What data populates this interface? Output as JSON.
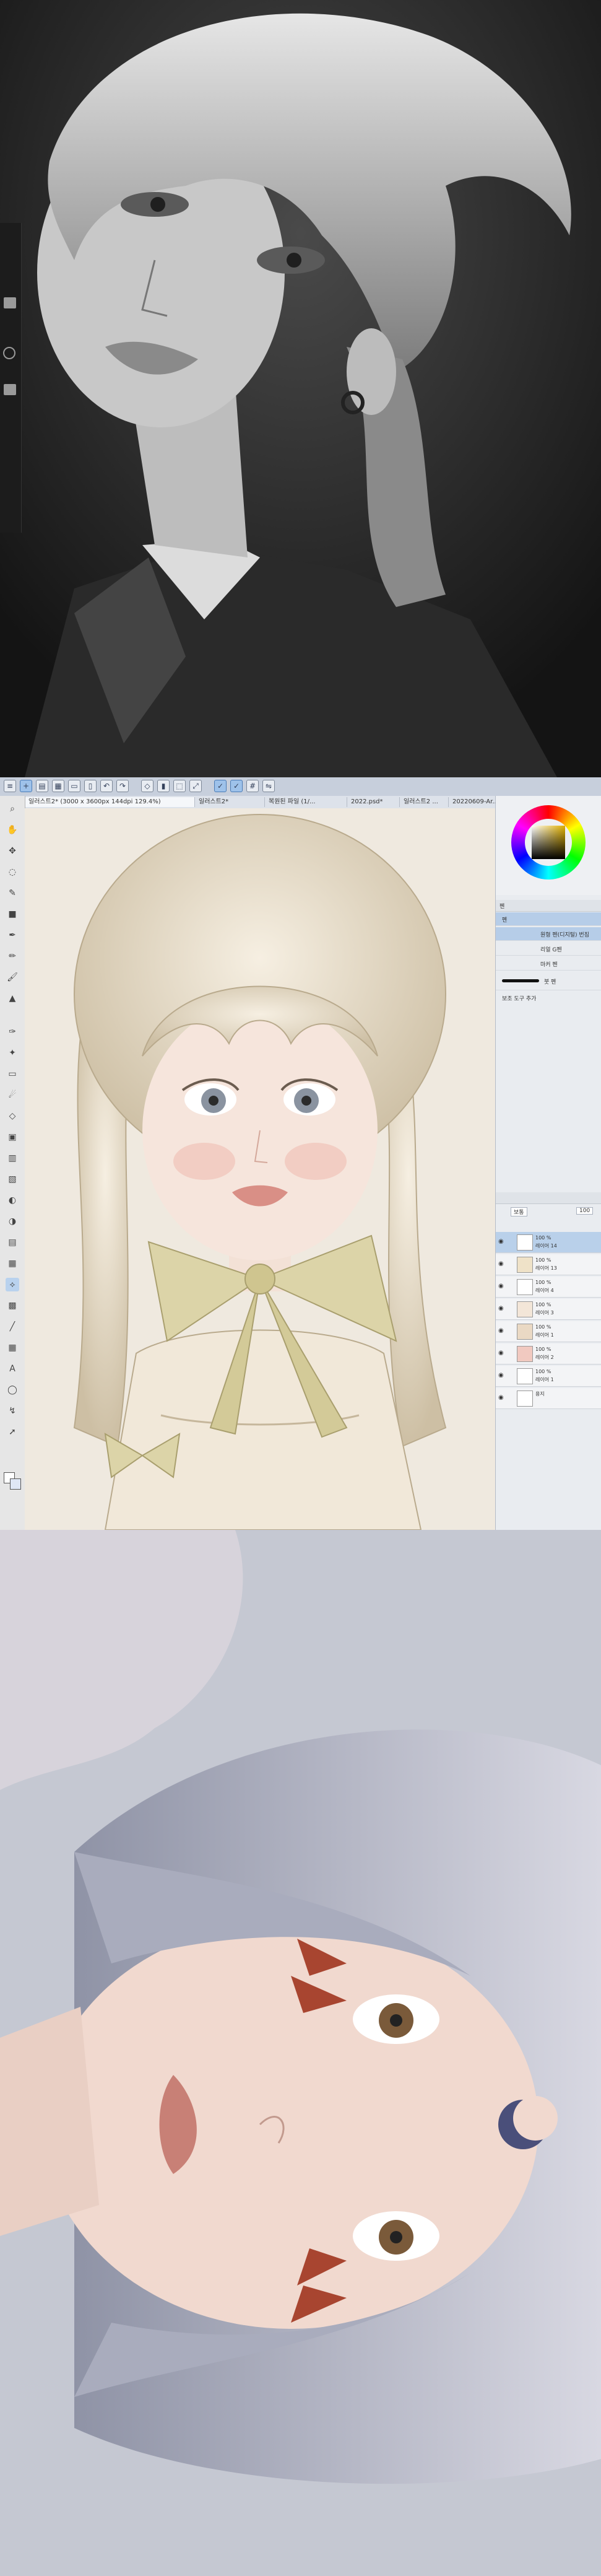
{
  "panel_top": {
    "description_none": "",
    "tablet_buttons": [
      "button",
      "circle-button",
      "button"
    ]
  },
  "csp": {
    "toolbar_icons": [
      "menu-icon",
      "new-icon",
      "open-icon",
      "save-icon",
      "undo-icon",
      "redo-icon",
      "clear-icon",
      "fill-icon",
      "select-icon",
      "transform-icon",
      "snap-icon",
      "ruler-icon",
      "grid-icon",
      "flip-icon"
    ],
    "tabs": [
      "일러스트2* (3000 x 3600px 144dpi 129.4%)",
      "일러스트2*",
      "복원된 파일 (1/...",
      "2022.psd*",
      "일러스트2 ...",
      "20220609-Ar..."
    ],
    "subtool_panel_title": "펜",
    "subtools": [
      "펜",
      "원형 펜(디지털) 번짐",
      "리얼 G펜",
      "마커 펜",
      "붓 펜"
    ],
    "subtool_add": "보조 도구 추가",
    "layer_panel": {
      "blend_mode": "보통",
      "opacity": "100",
      "layers": [
        {
          "pct": "100 %",
          "mode": "보통",
          "name": "레이어 14"
        },
        {
          "pct": "100 %",
          "mode": "보통",
          "name": "레이어 13"
        },
        {
          "pct": "100 %",
          "mode": "곱하기",
          "name": "레이어 4"
        },
        {
          "pct": "100 %",
          "mode": "보통",
          "name": "레이어 3"
        },
        {
          "pct": "100 %",
          "mode": "보통",
          "name": "레이어 1"
        },
        {
          "pct": "100 %",
          "mode": "보통",
          "name": "레이어 2"
        },
        {
          "pct": "100 %",
          "mode": "보통",
          "name": "레이어 1"
        },
        {
          "pct": "",
          "mode": "",
          "name": "용지"
        }
      ]
    }
  },
  "colors": {
    "accent": "#9ec2ea",
    "selected": "#b9d0ea"
  }
}
